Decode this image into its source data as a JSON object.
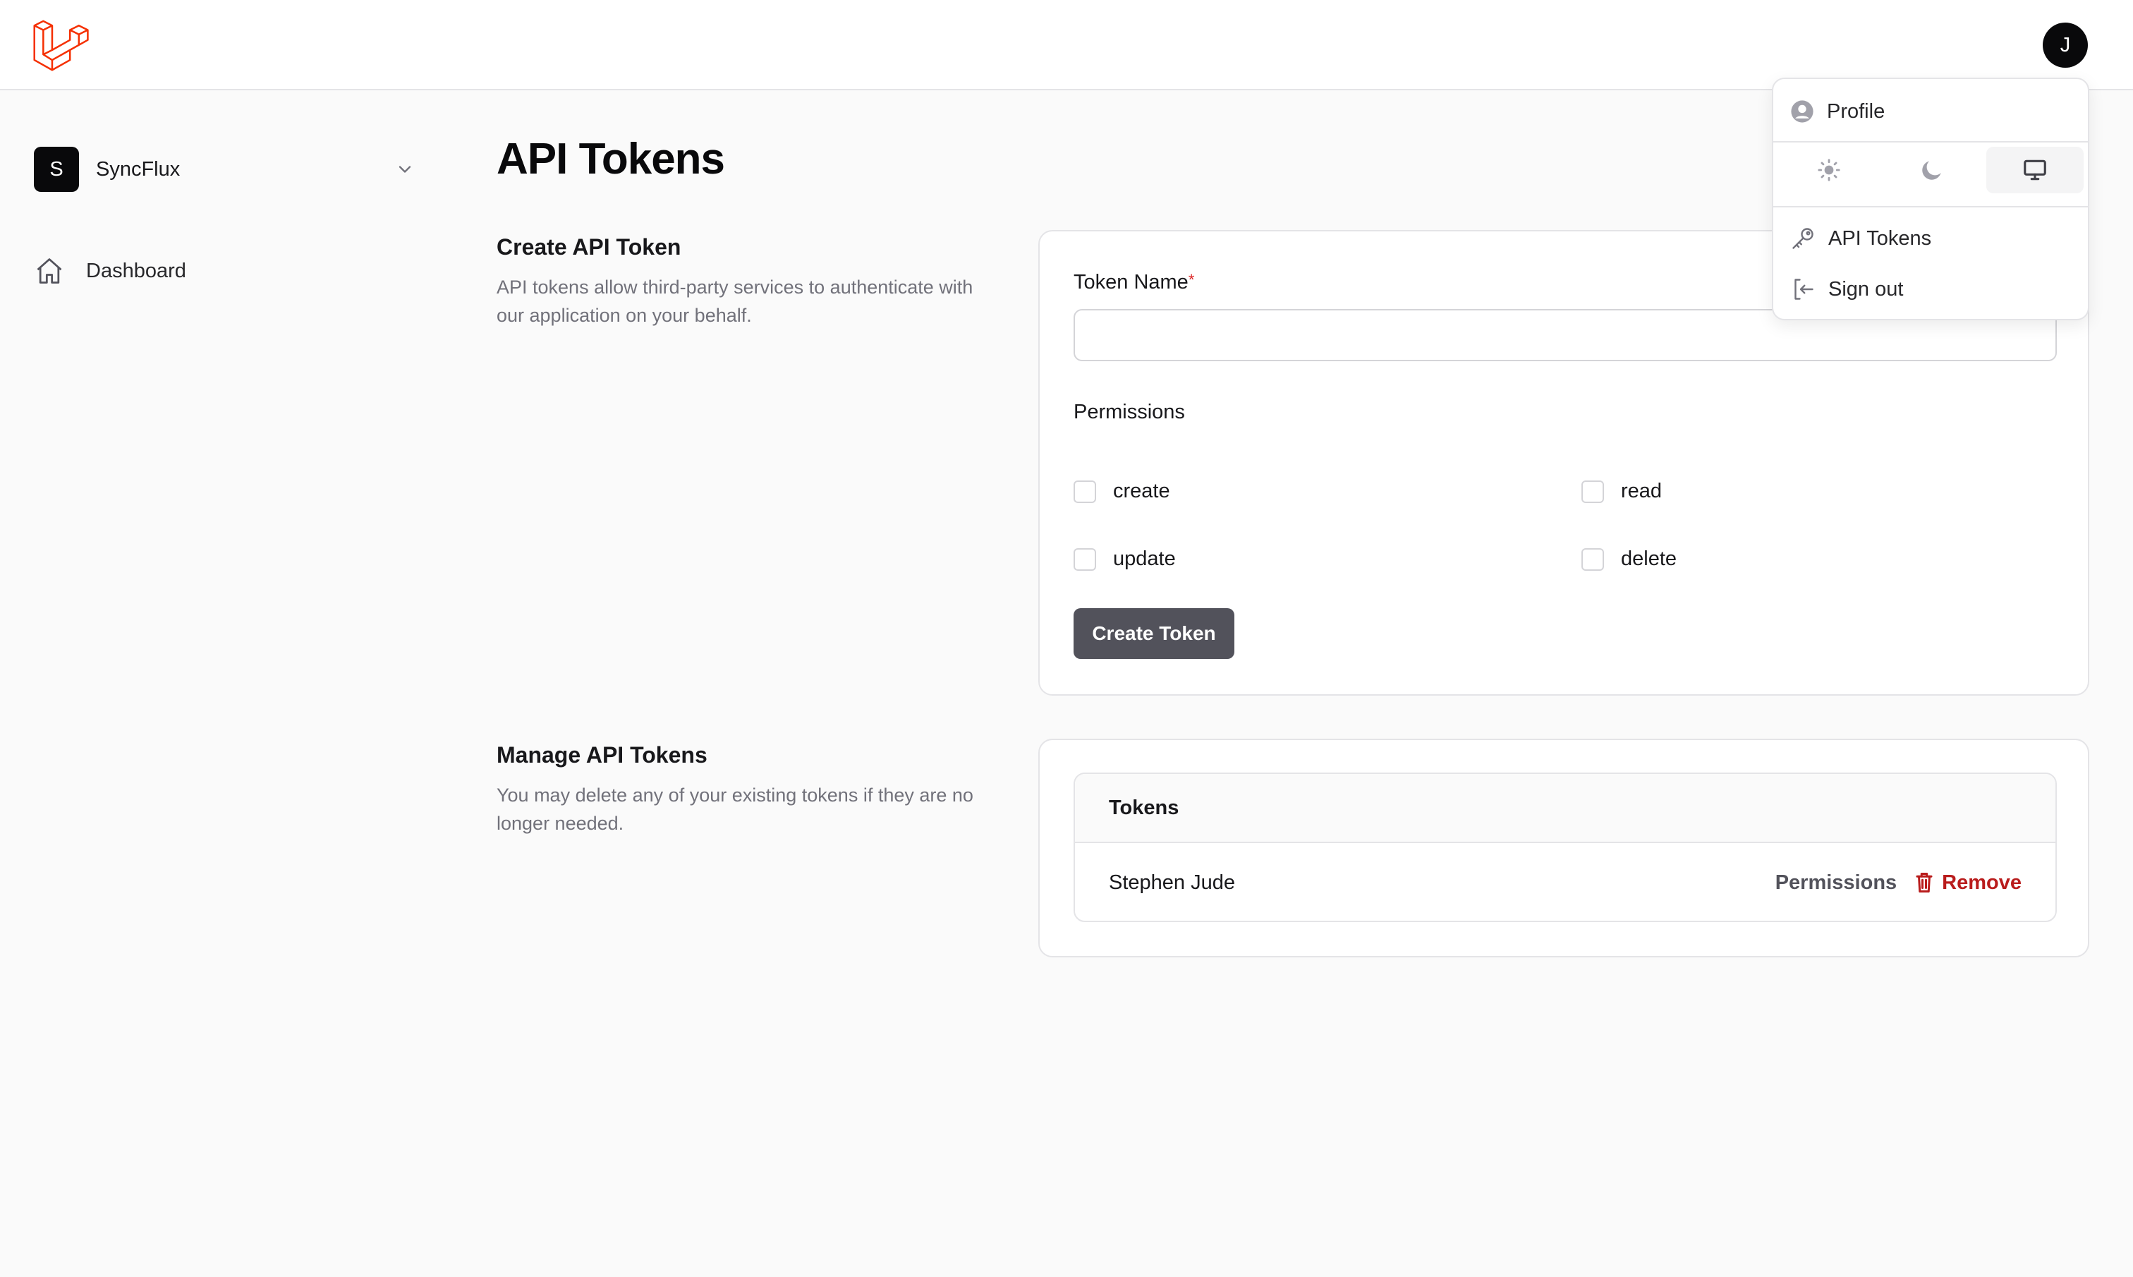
{
  "header": {
    "avatar_initial": "J",
    "logo_color": "#f53003"
  },
  "sidebar": {
    "team": {
      "initial": "S",
      "name": "SyncFlux"
    },
    "items": [
      {
        "label": "Dashboard",
        "icon": "home-icon"
      }
    ]
  },
  "main": {
    "title": "API Tokens",
    "create_section": {
      "heading": "Create API Token",
      "description": "API tokens allow third-party services to authenticate with our application on your behalf.",
      "token_name_label": "Token Name",
      "required_mark": "*",
      "token_name_value": "",
      "permissions_label": "Permissions",
      "permissions": [
        "create",
        "read",
        "update",
        "delete"
      ],
      "submit_label": "Create Token"
    },
    "manage_section": {
      "heading": "Manage API Tokens",
      "description": "You may delete any of your existing tokens if they are no longer needed.",
      "table_header": "Tokens",
      "tokens": [
        {
          "name": "Stephen Jude",
          "permissions_label": "Permissions",
          "remove_label": "Remove"
        }
      ]
    }
  },
  "dropdown": {
    "profile_label": "Profile",
    "themes": [
      "light",
      "dark",
      "system"
    ],
    "active_theme": "system",
    "api_tokens_label": "API Tokens",
    "sign_out_label": "Sign out"
  },
  "colors": {
    "accent_dark": "#09090b",
    "danger": "#b91c1c",
    "button": "#52525b"
  }
}
